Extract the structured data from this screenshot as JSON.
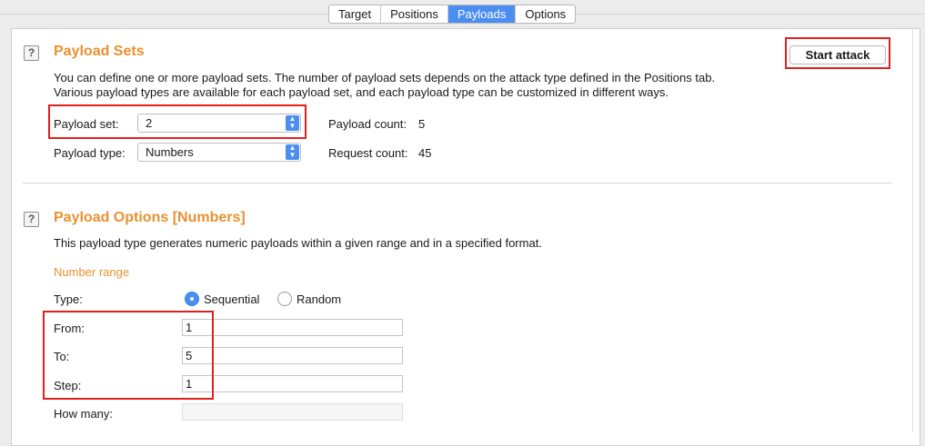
{
  "tabs": [
    {
      "label": "Target",
      "active": false
    },
    {
      "label": "Positions",
      "active": false
    },
    {
      "label": "Payloads",
      "active": true
    },
    {
      "label": "Options",
      "active": false
    }
  ],
  "payload_sets": {
    "title": "Payload Sets",
    "description_line1": "You can define one or more payload sets. The number of payload sets depends on the attack type defined in the Positions tab.",
    "description_line2": "Various payload types are available for each payload set, and each payload type can be customized in different ways.",
    "start_attack_label": "Start attack",
    "payload_set_label": "Payload set:",
    "payload_set_value": "2",
    "payload_type_label": "Payload type:",
    "payload_type_value": "Numbers",
    "payload_count_label": "Payload count:",
    "payload_count_value": "5",
    "request_count_label": "Request count:",
    "request_count_value": "45"
  },
  "payload_options": {
    "title": "Payload Options [Numbers]",
    "description": "This payload type generates numeric payloads within a given range and in a specified format.",
    "number_range_title": "Number range",
    "type_label": "Type:",
    "sequential_label": "Sequential",
    "random_label": "Random",
    "selected_type": "Sequential",
    "from_label": "From:",
    "from_value": "1",
    "to_label": "To:",
    "to_value": "5",
    "step_label": "Step:",
    "step_value": "1",
    "how_many_label": "How many:",
    "how_many_value": ""
  },
  "colors": {
    "accent": "#4a8ef2",
    "heading": "#e8912f",
    "highlight": "#e02020"
  }
}
